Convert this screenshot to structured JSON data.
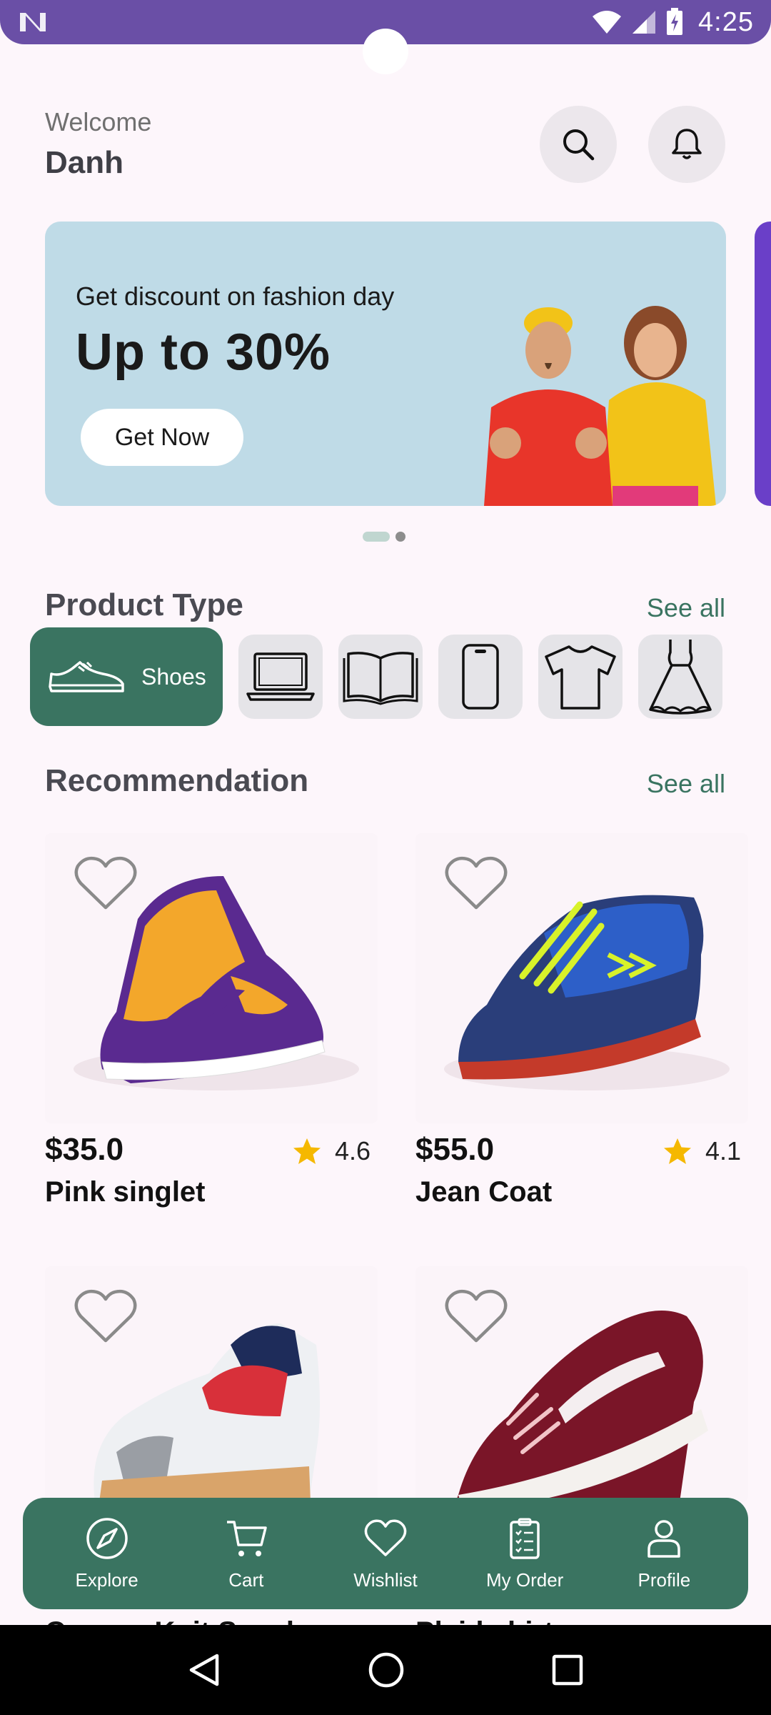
{
  "status": {
    "time": "4:25"
  },
  "header": {
    "welcome": "Welcome",
    "username": "Danh"
  },
  "banner": {
    "subtitle": "Get discount on fashion day",
    "headline": "Up to 30%",
    "cta": "Get Now"
  },
  "product_type": {
    "title": "Product Type",
    "see_all": "See all",
    "categories": [
      {
        "label": "Shoes",
        "icon": "shoe-icon",
        "selected": true
      },
      {
        "icon": "laptop-icon"
      },
      {
        "icon": "book-icon"
      },
      {
        "icon": "phone-icon"
      },
      {
        "icon": "tshirt-icon"
      },
      {
        "icon": "dress-icon"
      }
    ]
  },
  "recommendation": {
    "title": "Recommendation",
    "see_all": "See all",
    "products": [
      {
        "price": "$35.0",
        "rating": "4.6",
        "name": "Pink singlet"
      },
      {
        "price": "$55.0",
        "rating": "4.1",
        "name": "Jean Coat"
      },
      {
        "name": "Canvas Knit Sneaker"
      },
      {
        "name": "Plaid shirt"
      }
    ]
  },
  "nav": {
    "items": [
      "Explore",
      "Cart",
      "Wishlist",
      "My Order",
      "Profile"
    ]
  },
  "colors": {
    "primary": "#3a7461",
    "status_bar": "#6a4fa6",
    "banner_bg": "#bfdbe7",
    "star": "#f5b800"
  }
}
